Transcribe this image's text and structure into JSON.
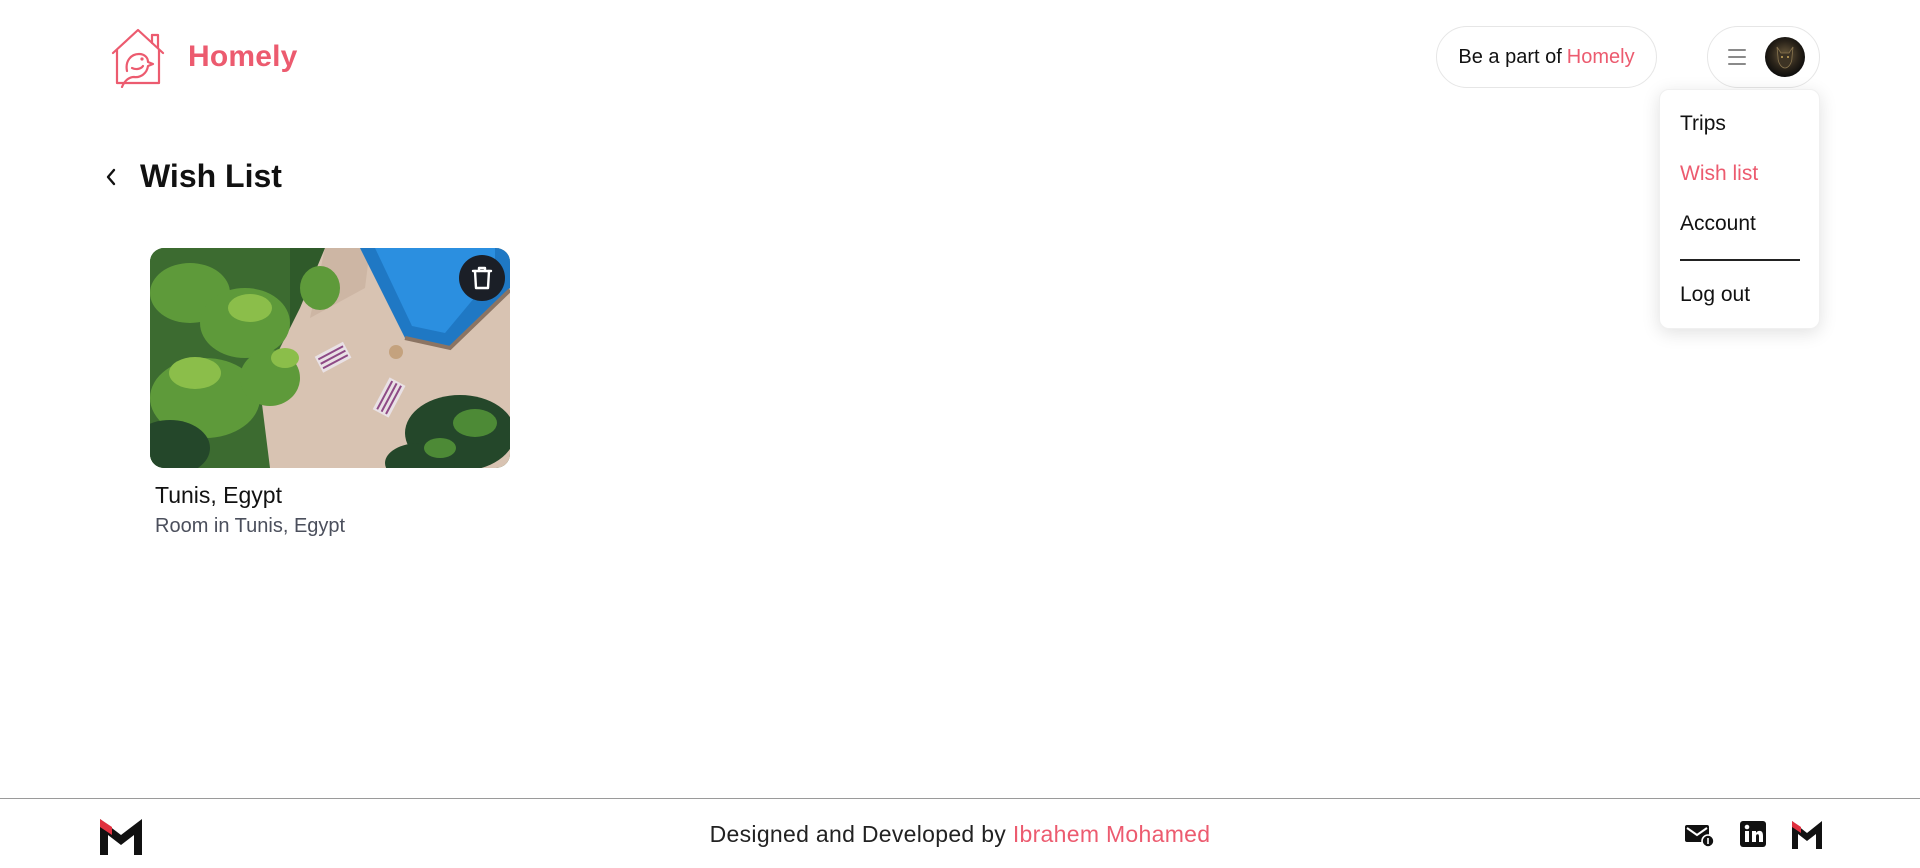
{
  "header": {
    "brand": "Homely",
    "partner_text": "Be a part of",
    "partner_brand": "Homely",
    "menu_icon": "hamburger-icon",
    "avatar_alt": "user avatar"
  },
  "dropdown": {
    "items": [
      {
        "label": "Trips",
        "active": false
      },
      {
        "label": "Wish list",
        "active": true
      },
      {
        "label": "Account",
        "active": false
      },
      {
        "label": "Log out",
        "active": false
      }
    ]
  },
  "page": {
    "title": "Wish List",
    "back_icon": "chevron-left-icon"
  },
  "wishlist": [
    {
      "title": "Tunis, Egypt",
      "subtitle": "Room in Tunis, Egypt",
      "delete_icon": "trash-icon"
    }
  ],
  "footer": {
    "credit_prefix": "Designed and Developed by",
    "credit_name": "Ibrahem Mohamed",
    "icons": [
      "mail-icon",
      "linkedin-icon",
      "m-logo-icon"
    ]
  },
  "colors": {
    "accent": "#ec5b6f",
    "text": "#111111",
    "muted": "#4b4f5c",
    "dark_button": "#1b1f27"
  }
}
